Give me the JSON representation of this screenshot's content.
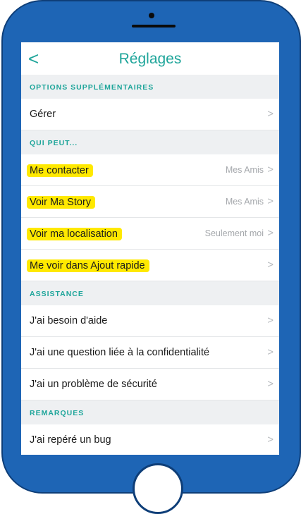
{
  "nav": {
    "back": "<",
    "title": "Réglages"
  },
  "sections": [
    {
      "title": "OPTIONS SUPPLÉMENTAIRES"
    },
    {
      "title": "QUI PEUT..."
    },
    {
      "title": "ASSISTANCE"
    },
    {
      "title": "REMARQUES"
    }
  ],
  "rows": [
    {
      "label": "Gérer",
      "value": "",
      "chevron": ">"
    },
    {
      "label": "Me contacter",
      "value": "Mes Amis",
      "chevron": ">"
    },
    {
      "label": "Voir Ma Story",
      "value": "Mes Amis",
      "chevron": ">"
    },
    {
      "label": "Voir ma localisation",
      "value": "Seulement moi",
      "chevron": ">"
    },
    {
      "label": "Me voir dans Ajout rapide",
      "value": "",
      "chevron": ">"
    },
    {
      "label": "J'ai besoin d'aide",
      "value": "",
      "chevron": ">"
    },
    {
      "label": "J'ai une question liée à la confidentialité",
      "value": "",
      "chevron": ">"
    },
    {
      "label": "J'ai un problème de sécurité",
      "value": "",
      "chevron": ">"
    },
    {
      "label": "J'ai repéré un bug",
      "value": "",
      "chevron": ">"
    }
  ],
  "colors": {
    "accent": "#1ea59a",
    "highlight": "#ffe900",
    "phone": "#1e65b5"
  }
}
